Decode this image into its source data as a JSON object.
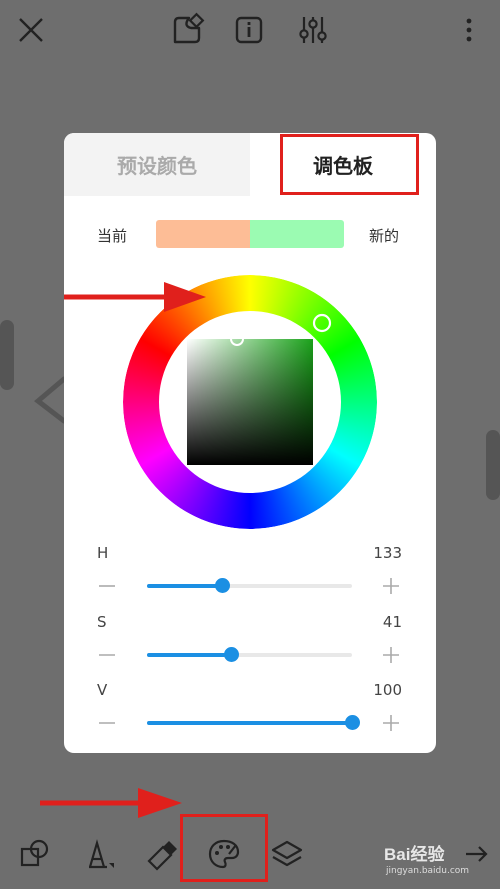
{
  "toolbar": {
    "icons": [
      "close-icon",
      "shape-edit-icon",
      "info-icon",
      "adjust-sliders-icon",
      "more-vertical-icon"
    ]
  },
  "dialog": {
    "tabs": {
      "preset": "预设颜色",
      "palette": "调色板"
    },
    "compare": {
      "current_label": "当前",
      "new_label": "新的",
      "current_color": "#fdbd96",
      "new_color": "#9bfbb2"
    },
    "hsv": {
      "h": {
        "label": "H",
        "value": "133",
        "fraction": 0.37
      },
      "s": {
        "label": "S",
        "value": "41",
        "fraction": 0.41
      },
      "v": {
        "label": "V",
        "value": "100",
        "fraction": 1.0
      }
    }
  },
  "bottom_bar": {
    "icons": [
      "shapes-icon",
      "pen-icon",
      "eraser-icon",
      "palette-icon",
      "layers-icon",
      "redo-icon"
    ]
  },
  "watermark": {
    "brand": "Bai经验",
    "site": "jingyan.baidu.com"
  },
  "colors": {
    "overlay": "#6e6e6e",
    "accent": "#1b8fe3",
    "annotation_red": "#e0201c"
  }
}
